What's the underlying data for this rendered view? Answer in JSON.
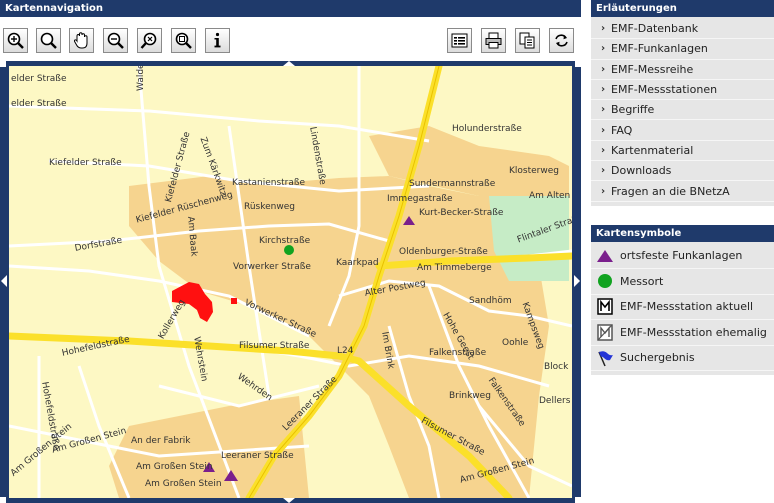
{
  "left_panel": {
    "title": "Kartennavigation"
  },
  "toolbar": {
    "left_tools": [
      {
        "name": "zoom-in-icon"
      },
      {
        "name": "zoom-box-icon"
      },
      {
        "name": "pan-hand-icon"
      },
      {
        "name": "zoom-out-icon"
      },
      {
        "name": "zoom-reset-icon"
      },
      {
        "name": "zoom-full-icon"
      },
      {
        "name": "info-icon"
      }
    ],
    "right_tools": [
      {
        "name": "legend-icon"
      },
      {
        "name": "print-icon"
      },
      {
        "name": "copy-icon"
      },
      {
        "name": "refresh-icon"
      }
    ]
  },
  "map": {
    "colors": {
      "background": "#fdf8c4",
      "built_area": "#f6d48f",
      "major_road": "#fbe02a",
      "green": "#c6ecc6",
      "minor_road": "#ffffff"
    },
    "street_labels": [
      "elder Straße",
      "elder Straße",
      "Waldenweg",
      "Kiefelder Straße",
      "Kiefelder Straße",
      "Zum Kärkwitz",
      "Lindenstraße",
      "Kastanienstraße",
      "Kiefelder Rüschenweg",
      "Rüskenweg",
      "Holunderstraße",
      "Sundermannstraße",
      "Immegastraße",
      "Kurt-Becker-Straße",
      "Klosterweg",
      "Am Alten",
      "Flintaler Straße",
      "Am Baak",
      "Kirchstraße",
      "Vorwerker Straße",
      "Oldenburger-Straße",
      "Kaarkpad",
      "Am Timmeberge",
      "Dorfstraße",
      "Alter Postweg",
      "Sandhöm",
      "Vorwerker Straße",
      "Kollerweg",
      "Hohe Geest",
      "Kampsweg",
      "Hohefeldstraße",
      "Filsumer Straße",
      "L24",
      "Falkenstraße",
      "Oohle",
      "Block",
      "Wehrstein",
      "Wehrden",
      "Leeraner Straße",
      "Im Brink",
      "Brinkweg",
      "Falkenstraße",
      "Dellers",
      "Hohefeldstraße",
      "Filsumer Straße",
      "An der Fabrik",
      "Leeraner Straße",
      "Am Großen Stein",
      "Am Großen Stein",
      "Am Großen Stein",
      "Am Großen Stein",
      "Am Großen Stein"
    ]
  },
  "erlaeuterungen": {
    "title": "Erläuterungen",
    "items": [
      "EMF-Datenbank",
      "EMF-Funkanlagen",
      "EMF-Messreihe",
      "EMF-Messstationen",
      "Begriffe",
      "FAQ",
      "Kartenmaterial",
      "Downloads",
      "Fragen an die BNetzA"
    ]
  },
  "kartensymbole": {
    "title": "Kartensymbole",
    "items": [
      {
        "icon": "purple-triangle-icon",
        "label": "ortsfeste Funkanlagen"
      },
      {
        "icon": "green-dot-icon",
        "label": "Messort"
      },
      {
        "icon": "station-current-icon",
        "label": "EMF-Messstation aktuell"
      },
      {
        "icon": "station-former-icon",
        "label": "EMF-Messstation ehemalig"
      },
      {
        "icon": "blue-flag-icon",
        "label": "Suchergebnis"
      }
    ]
  }
}
